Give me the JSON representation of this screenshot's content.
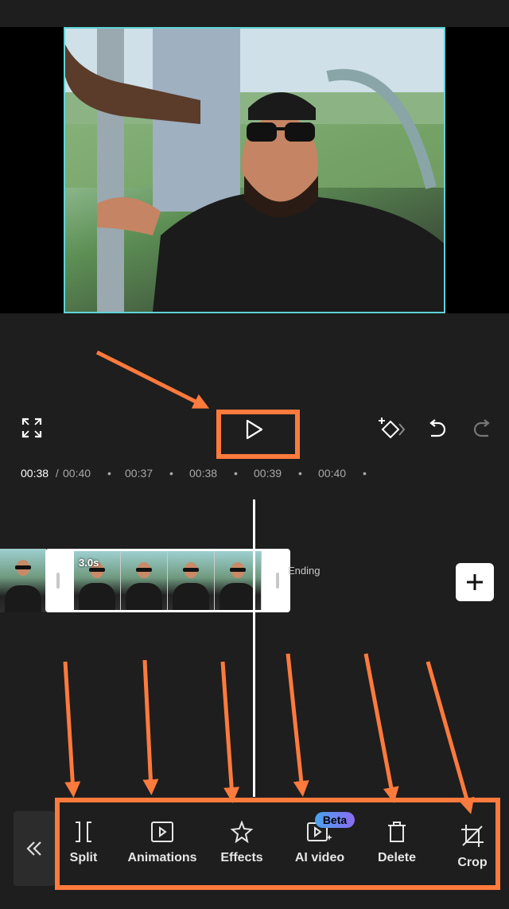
{
  "timecode": {
    "current": "00:38",
    "separator": " / ",
    "total": "00:40",
    "ruler": [
      "00:37",
      "00:38",
      "00:39",
      "00:40"
    ]
  },
  "timeline": {
    "clip_duration": "3.0s",
    "ending_label": "Ending"
  },
  "toolbar": {
    "items": [
      {
        "label": "Split",
        "icon": "split-icon"
      },
      {
        "label": "Animations",
        "icon": "animations-icon"
      },
      {
        "label": "Effects",
        "icon": "effects-icon"
      },
      {
        "label": "AI video",
        "icon": "ai-video-icon",
        "badge": "Beta"
      },
      {
        "label": "Delete",
        "icon": "delete-icon"
      },
      {
        "label": "Crop",
        "icon": "crop-icon"
      }
    ]
  },
  "colors": {
    "annotation": "#ff7a3d",
    "selection_border": "#5fd3d8",
    "background": "#1e1e1e",
    "beta_gradient": [
      "#4aa3f0",
      "#8a6cf2"
    ]
  }
}
